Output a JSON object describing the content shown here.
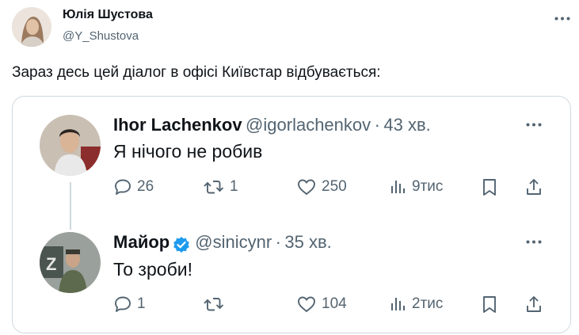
{
  "author": {
    "name": "Юлія Шустова",
    "handle": "@Y_Shustova"
  },
  "post_text": "Зараз десь цей діалог в офісі Київстар відбувається:",
  "thread": [
    {
      "name": "Ihor Lachenkov",
      "handle": "@igorlachenkov",
      "sep": "·",
      "time": "43 хв.",
      "text": "Я нічого не робив",
      "replies": "26",
      "reposts": "1",
      "likes": "250",
      "views": "9тис"
    },
    {
      "name": "Майор",
      "handle": "@sinicynr",
      "sep": "·",
      "time": "35 хв.",
      "text": "То зроби!",
      "replies": "1",
      "reposts": "",
      "likes": "104",
      "views": "2тис",
      "verified": true
    }
  ],
  "colors": {
    "muted": "#536471",
    "border": "#cfd9de",
    "verified": "#1d9bf0"
  }
}
